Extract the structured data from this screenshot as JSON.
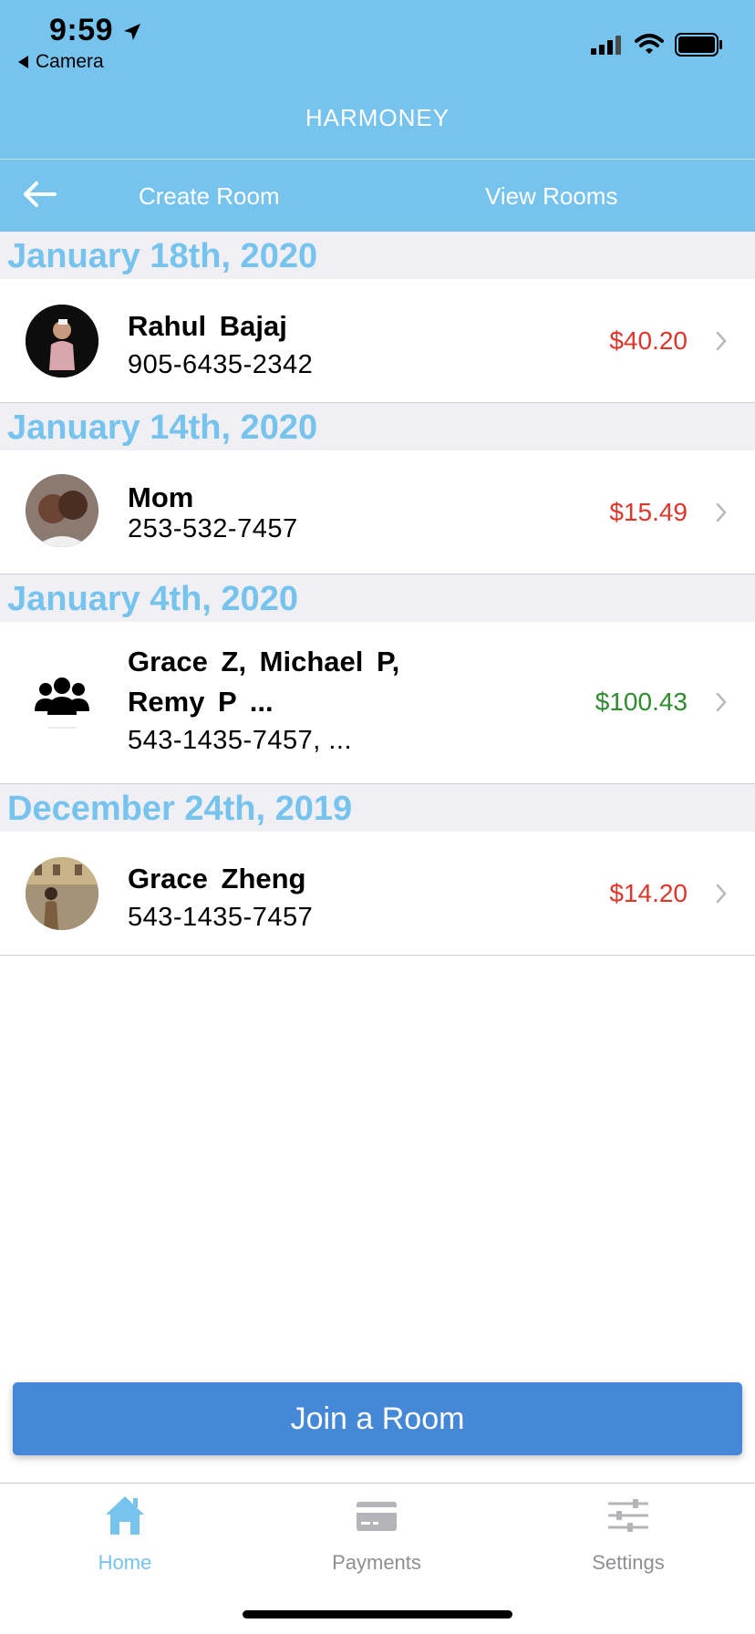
{
  "status_bar": {
    "time": "9:59",
    "back_label": "Camera"
  },
  "header": {
    "app_title": "HARMONEY",
    "nav": {
      "create_room": "Create Room",
      "view_rooms": "View Rooms"
    }
  },
  "sections": [
    {
      "date": "January 18th, 2020",
      "row": {
        "name": "Rahul Bajaj",
        "phone": "905-6435-2342",
        "amount": "$40.20",
        "amount_color": "#e0352b",
        "avatar_icon": "person-photo-avatar"
      }
    },
    {
      "date": "January 14th, 2020",
      "row": {
        "name": "Mom",
        "phone": "253-532-7457",
        "amount": "$15.49",
        "amount_color": "#e0352b",
        "avatar_icon": "person-photo-avatar"
      }
    },
    {
      "date": "January 4th, 2020",
      "row": {
        "name_line1": "Grace Z, Michael P,",
        "name_line2": "Remy P ...",
        "phone": "543-1435-7457, ...",
        "amount": "$100.43",
        "amount_color": "#2e8b2e",
        "avatar_icon": "group-icon"
      }
    },
    {
      "date": "December 24th, 2019",
      "row": {
        "name": "Grace Zheng",
        "phone": "543-1435-7457",
        "amount": "$14.20",
        "amount_color": "#e0352b",
        "avatar_icon": "person-photo-avatar"
      }
    }
  ],
  "join_button": "Join a Room",
  "tabs": [
    {
      "label": "Home",
      "icon": "home-icon",
      "active": true
    },
    {
      "label": "Payments",
      "icon": "credit-card-icon",
      "active": false
    },
    {
      "label": "Settings",
      "icon": "sliders-icon",
      "active": false
    }
  ],
  "colors": {
    "header_bg": "#76c3ee",
    "accent_blue": "#76c3ee",
    "button_blue": "#4688d8",
    "debt_red": "#e0352b",
    "credit_green": "#2e8b2e"
  }
}
